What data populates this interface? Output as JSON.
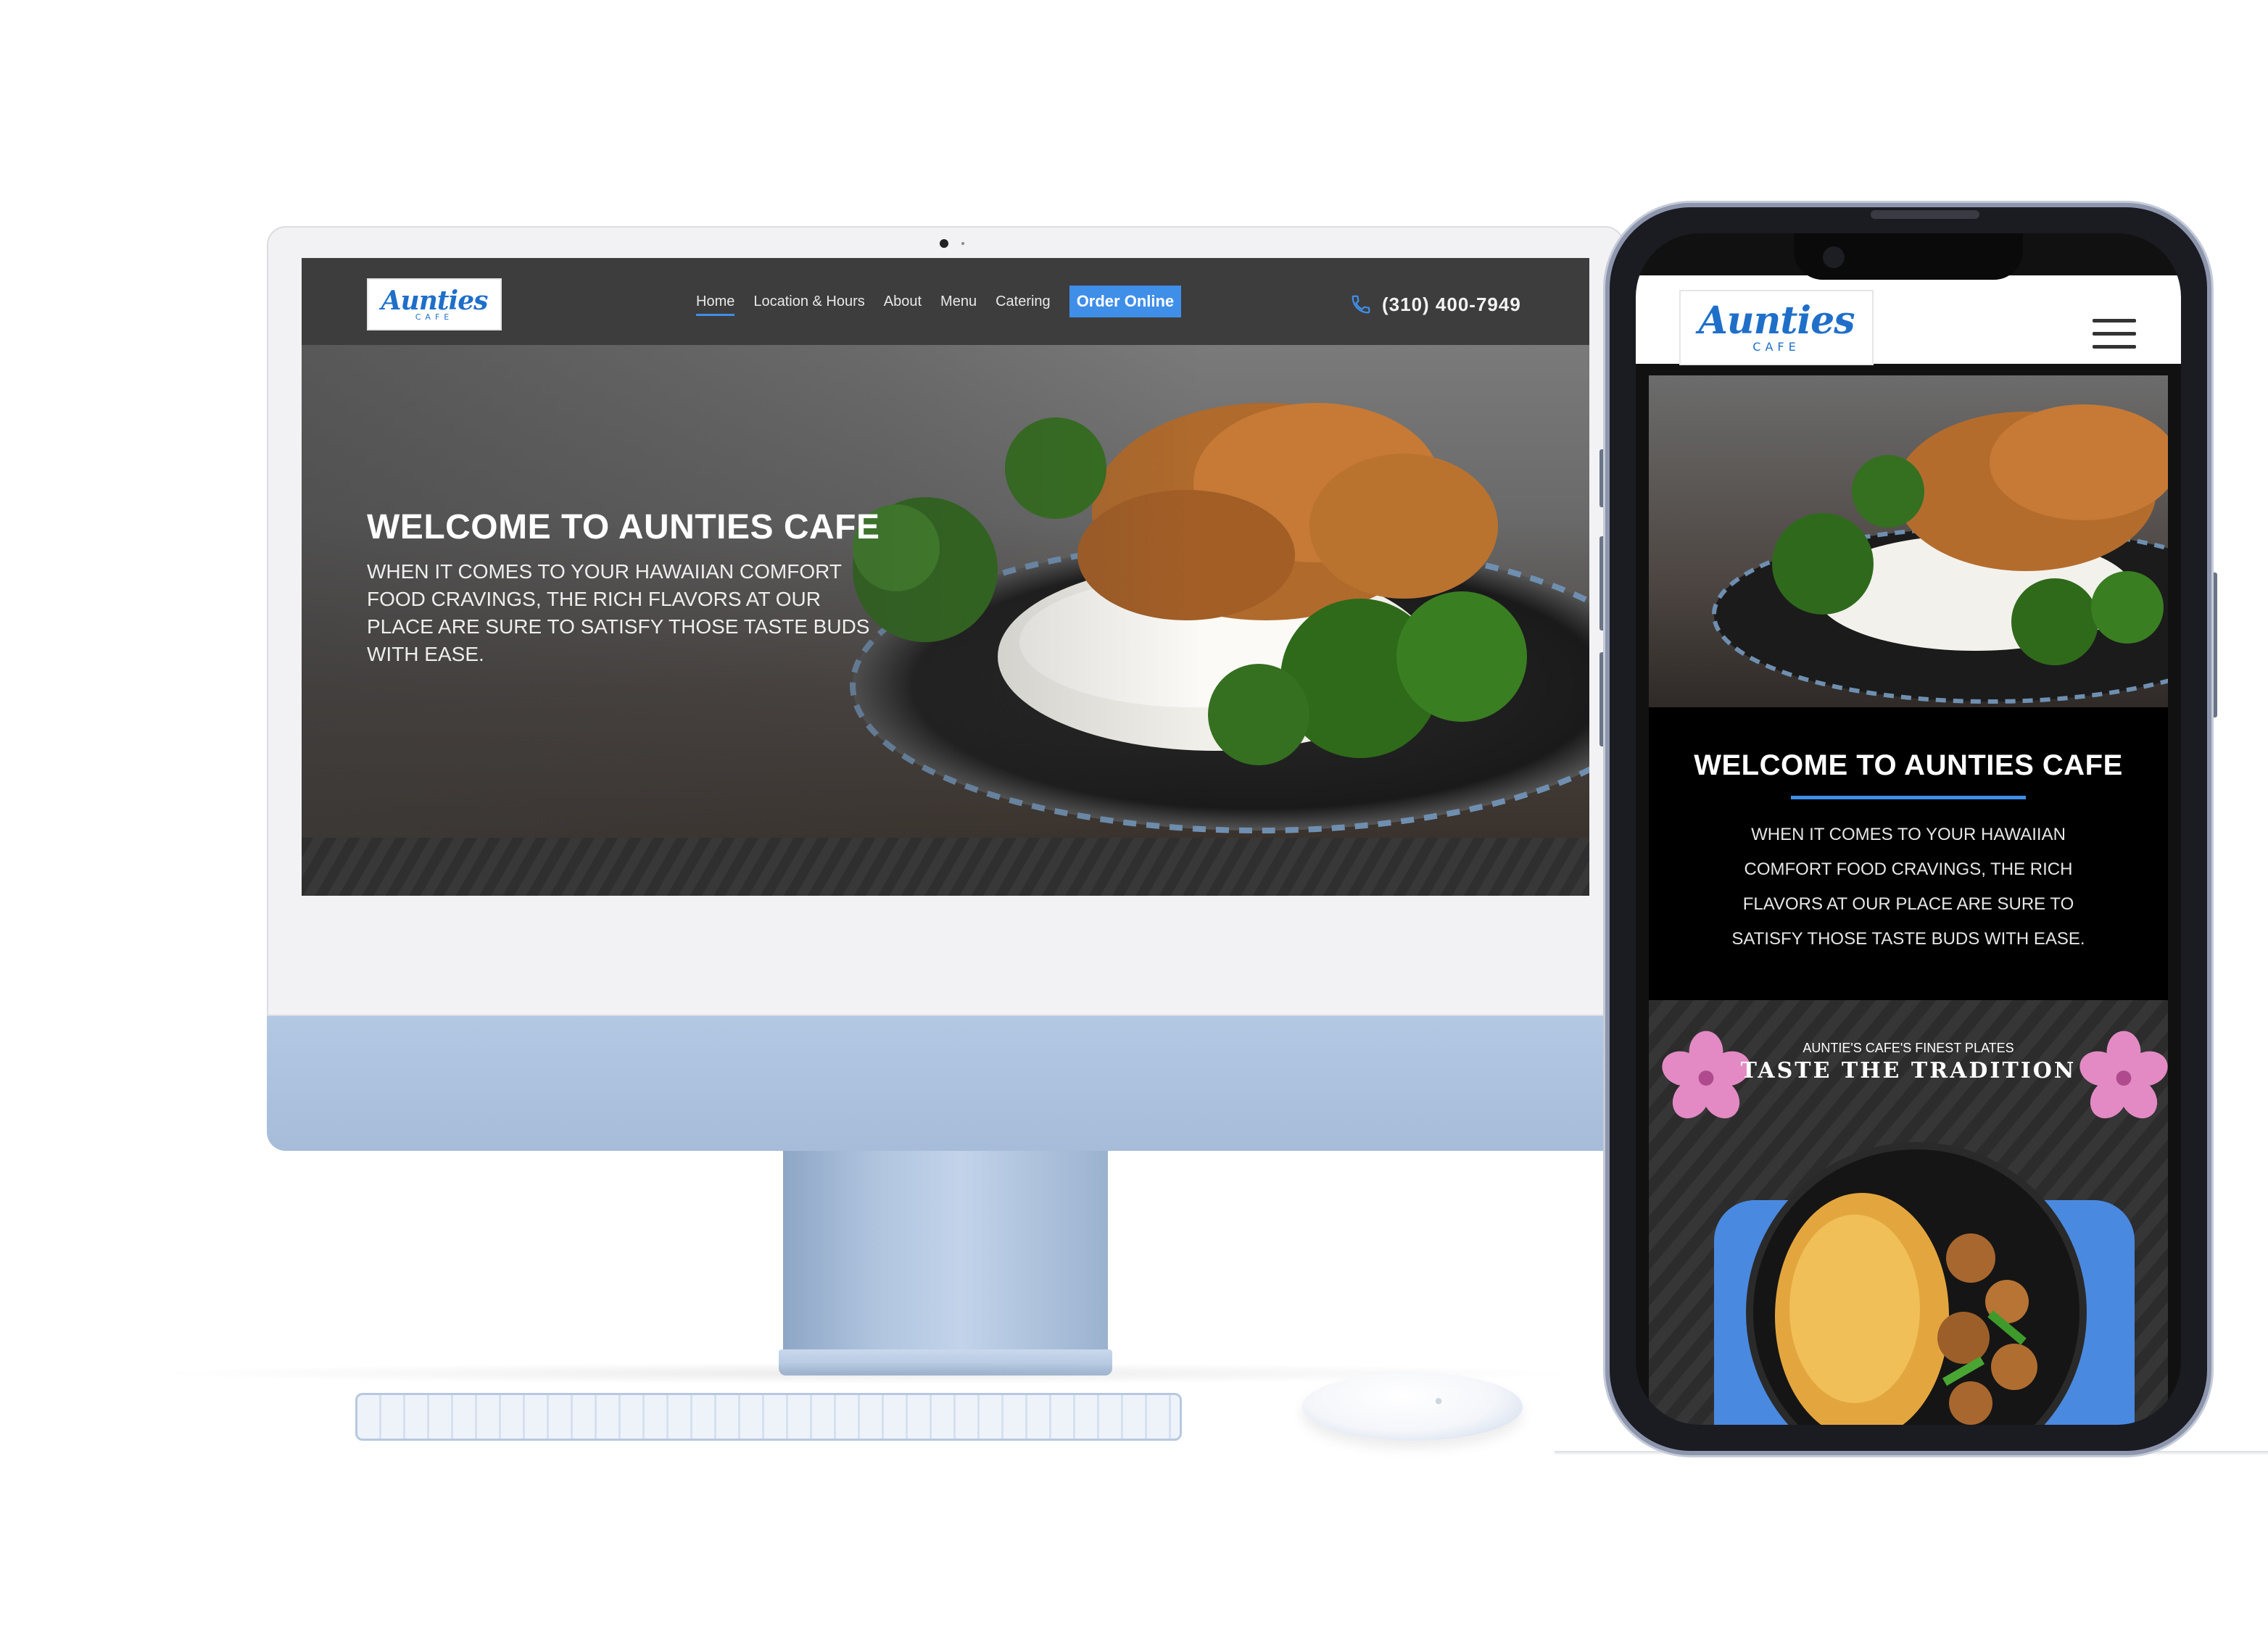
{
  "desktop": {
    "logo": {
      "main": "Aunties",
      "sub": "CAFE"
    },
    "nav": {
      "items": [
        {
          "label": "Home",
          "active": true
        },
        {
          "label": "Location & Hours",
          "active": false
        },
        {
          "label": "About",
          "active": false
        },
        {
          "label": "Menu",
          "active": false
        },
        {
          "label": "Catering",
          "active": false
        }
      ],
      "order_button": "Order Online"
    },
    "phone": {
      "icon": "phone-icon",
      "number": "(310) 400-7949"
    },
    "hero": {
      "title": "WELCOME TO AUNTIES CAFE",
      "text": "WHEN IT COMES TO YOUR HAWAIIAN COMFORT FOOD CRAVINGS, THE RICH FLAVORS AT OUR PLACE ARE SURE TO SATISFY THOSE TASTE BUDS WITH EASE.",
      "image": "fried-chicken-plate-with-rice-and-broccoli"
    }
  },
  "mobile": {
    "logo": {
      "main": "Aunties",
      "sub": "CAFE"
    },
    "menu_icon": "hamburger-menu-icon",
    "hero_image": "fried-chicken-plate-with-rice-and-broccoli",
    "welcome": {
      "title": "WELCOME TO AUNTIES CAFE",
      "text": "WHEN IT COMES TO YOUR HAWAIIAN COMFORT FOOD CRAVINGS, THE RICH FLAVORS AT OUR PLACE ARE SURE TO SATISFY THOSE TASTE BUDS WITH EASE."
    },
    "taste": {
      "subtitle": "AUNTIE'S CAFE'S FINEST PLATES",
      "title": "TASTE THE TRADITION",
      "decor": "hibiscus-flower-icon",
      "image": "omelette-with-potatoes-plate"
    }
  },
  "colors": {
    "accent": "#3f8ee8",
    "header_bg": "#3d3d3d",
    "logo_blue": "#1f6fc9",
    "hibiscus_pink": "#e38ac4",
    "imac_blue": "#a9bfdc"
  }
}
